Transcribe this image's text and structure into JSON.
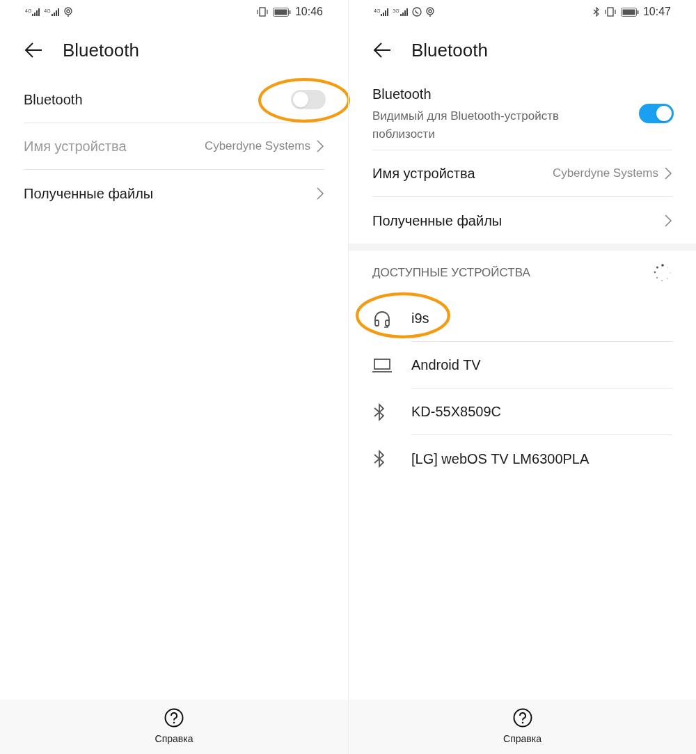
{
  "screens": [
    {
      "status_bar": {
        "networks": [
          "4G",
          "4G"
        ],
        "viber": false,
        "bluetooth": false,
        "time": "10:46"
      },
      "title": "Bluetooth",
      "bluetooth": {
        "label": "Bluetooth",
        "on": false,
        "highlighted": true
      },
      "rows": [
        {
          "label": "Имя устройства",
          "value": "Cyberdyne Systems",
          "disabled": true
        },
        {
          "label": "Полученные файлы",
          "disabled": false
        }
      ],
      "help": "Справка"
    },
    {
      "status_bar": {
        "networks": [
          "4G",
          "3G"
        ],
        "viber": true,
        "bluetooth": true,
        "time": "10:47"
      },
      "title": "Bluetooth",
      "bluetooth": {
        "label": "Bluetooth",
        "subtitle": "Видимый для Bluetooth-устройств поблизости",
        "on": true,
        "highlighted": false
      },
      "rows": [
        {
          "label": "Имя устройства",
          "value": "Cyberdyne Systems",
          "disabled": false
        },
        {
          "label": "Полученные файлы",
          "disabled": false
        }
      ],
      "available": {
        "header": "ДОСТУПНЫЕ УСТРОЙСТВА",
        "devices": [
          {
            "kind": "headset",
            "name": "i9s",
            "highlighted": true
          },
          {
            "kind": "laptop",
            "name": "Android TV",
            "highlighted": false
          },
          {
            "kind": "bluetooth",
            "name": "KD-55X8509C",
            "highlighted": false
          },
          {
            "kind": "bluetooth",
            "name": "[LG] webOS TV LM6300PLA",
            "highlighted": false
          }
        ]
      },
      "help": "Справка"
    }
  ]
}
